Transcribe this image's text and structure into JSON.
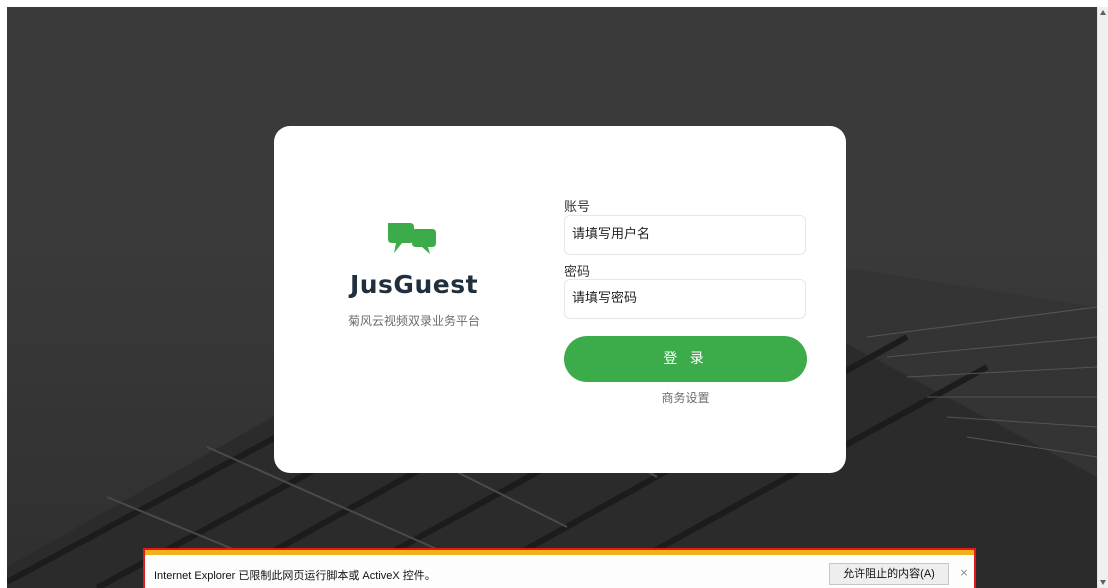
{
  "login": {
    "brand_name": "JusGuest",
    "tagline": "菊风云视频双录业务平台",
    "account_label": "账号",
    "account_placeholder": "请填写用户名",
    "password_label": "密码",
    "password_placeholder": "请填写密码",
    "login_button": "登 录",
    "business_settings_link": "商务设置"
  },
  "ie_notification": {
    "message": "Internet Explorer 已限制此网页运行脚本或 ActiveX 控件。",
    "allow_button": "允许阻止的内容(A)",
    "close_icon": "×"
  },
  "colors": {
    "accent_green": "#3cab4a",
    "backdrop": "#3b3b3b",
    "notification_border": "#e11919",
    "notification_top": "#f0b11a"
  },
  "icons": {
    "logo": "chat-bubbles-icon",
    "close": "close-icon"
  }
}
